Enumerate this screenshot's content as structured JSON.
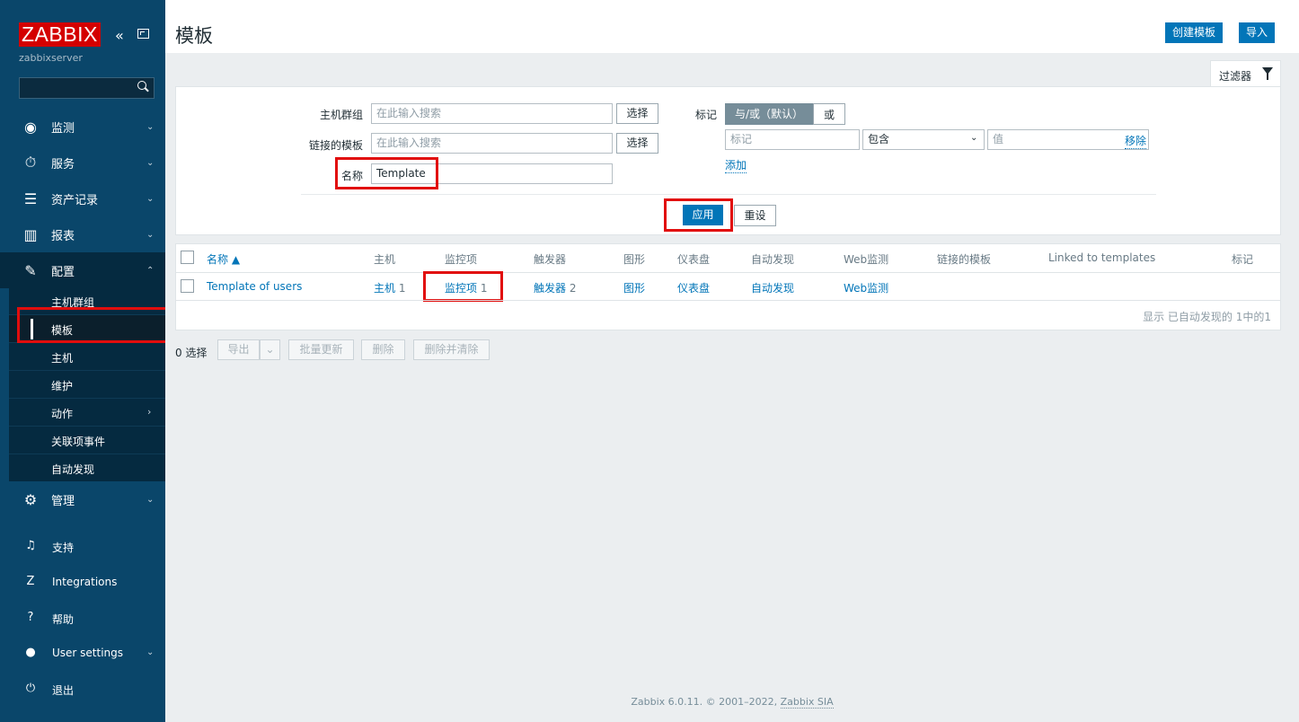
{
  "sidebar": {
    "logo": "ZABBIX",
    "server_name": "zabbixserver",
    "collapse_glyph": "«",
    "menu": [
      {
        "label": "监测",
        "icon": "eye-icon",
        "glyph": "◉",
        "chevron": "⌄"
      },
      {
        "label": "服务",
        "icon": "stopwatch-icon",
        "glyph": "⏱",
        "chevron": "⌄"
      },
      {
        "label": "资产记录",
        "icon": "list-icon",
        "glyph": "☰",
        "chevron": "⌄"
      },
      {
        "label": "报表",
        "icon": "bar-chart-icon",
        "glyph": "▥",
        "chevron": "⌄"
      },
      {
        "label": "配置",
        "icon": "wrench-icon",
        "glyph": "✎",
        "chevron": "⌃"
      }
    ],
    "submenu": [
      {
        "label": "主机群组"
      },
      {
        "label": "模板"
      },
      {
        "label": "主机"
      },
      {
        "label": "维护"
      },
      {
        "label": "动作",
        "chevron": "›"
      },
      {
        "label": "关联项事件"
      },
      {
        "label": "自动发现"
      }
    ],
    "admin": {
      "label": "管理",
      "glyph": "⚙",
      "chevron": "⌄"
    },
    "bottom": [
      {
        "label": "支持",
        "glyph": "♫"
      },
      {
        "label": "Integrations",
        "glyph": "Z"
      },
      {
        "label": "帮助",
        "glyph": "?"
      },
      {
        "label": "User settings",
        "glyph": "●",
        "chevron": "⌄"
      },
      {
        "label": "退出",
        "glyph": "⏻"
      }
    ]
  },
  "header": {
    "title": "模板",
    "create_button": "创建模板",
    "import_button": "导入"
  },
  "filter": {
    "tab_label": "过滤器",
    "host_group_label": "主机群组",
    "host_group_placeholder": "在此输入搜索",
    "linked_templates_label": "链接的模板",
    "linked_templates_placeholder": "在此输入搜索",
    "name_label": "名称",
    "name_value": "Template",
    "select_button": "选择",
    "tags_label": "标记",
    "tags_andor": "与/或（默认）",
    "tags_or": "或",
    "tag_placeholder": "标记",
    "tag_operator": "包含",
    "tag_value_placeholder": "值",
    "remove_link": "移除",
    "add_link": "添加",
    "apply_button": "应用",
    "reset_button": "重设"
  },
  "table": {
    "columns": [
      "名称 ▲",
      "主机",
      "监控项",
      "触发器",
      "图形",
      "仪表盘",
      "自动发现",
      "Web监测",
      "链接的模板",
      "Linked to templates",
      "标记"
    ],
    "rows": [
      {
        "name": "Template of users",
        "hosts": "主机",
        "hosts_count": "1",
        "items": "监控项",
        "items_count": "1",
        "triggers": "触发器",
        "triggers_count": "2",
        "graphs": "图形",
        "dashboards": "仪表盘",
        "discovery": "自动发现",
        "web": "Web监测"
      }
    ],
    "summary": "显示 已自动发现的 1中的1"
  },
  "mass_actions": {
    "selected": "0 选择",
    "export": "导出",
    "export_arrow": "⌄",
    "mass_update": "批量更新",
    "delete": "删除",
    "delete_clear": "删除并清除"
  },
  "footer": {
    "text": "Zabbix 6.0.11. © 2001–2022,",
    "link": "Zabbix SIA"
  }
}
